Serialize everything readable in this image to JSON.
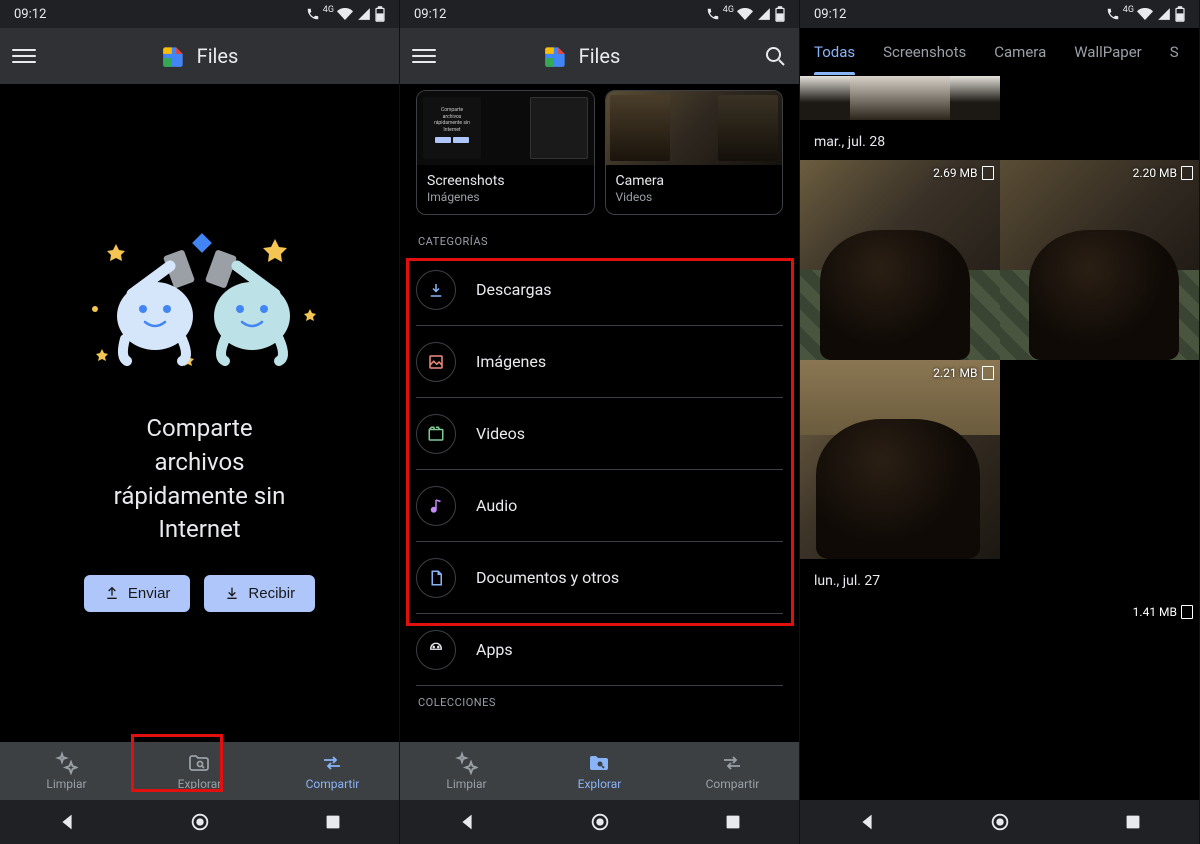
{
  "status": {
    "time": "09:12",
    "network": "4G"
  },
  "header": {
    "app_title": "Files"
  },
  "screen1": {
    "promo_line1": "Comparte",
    "promo_line2": "archivos",
    "promo_line3": "rápidamente sin",
    "promo_line4": "Internet",
    "send_label": "Enviar",
    "receive_label": "Recibir"
  },
  "bottom_nav": {
    "clean": "Limpiar",
    "explore": "Explorar",
    "share": "Compartir"
  },
  "screen2": {
    "cards": {
      "screenshots": {
        "title": "Screenshots",
        "sub": "Imágenes"
      },
      "camera": {
        "title": "Camera",
        "sub": "Videos"
      }
    },
    "section_categories": "CATEGORÍAS",
    "section_collections": "COLECCIONES",
    "categories": {
      "downloads": "Descargas",
      "images": "Imágenes",
      "videos": "Videos",
      "audio": "Audio",
      "documents": "Documentos y otros",
      "apps": "Apps"
    }
  },
  "screen3": {
    "tabs": {
      "all": "Todas",
      "screenshots": "Screenshots",
      "camera": "Camera",
      "wallpaper": "WallPaper"
    },
    "dates": {
      "d1": "mar., jul. 28",
      "d2": "lun., jul. 27"
    },
    "sizes": {
      "a": "2.69 MB",
      "b": "2.20 MB",
      "c": "2.21 MB",
      "d": "1.41 MB"
    }
  }
}
